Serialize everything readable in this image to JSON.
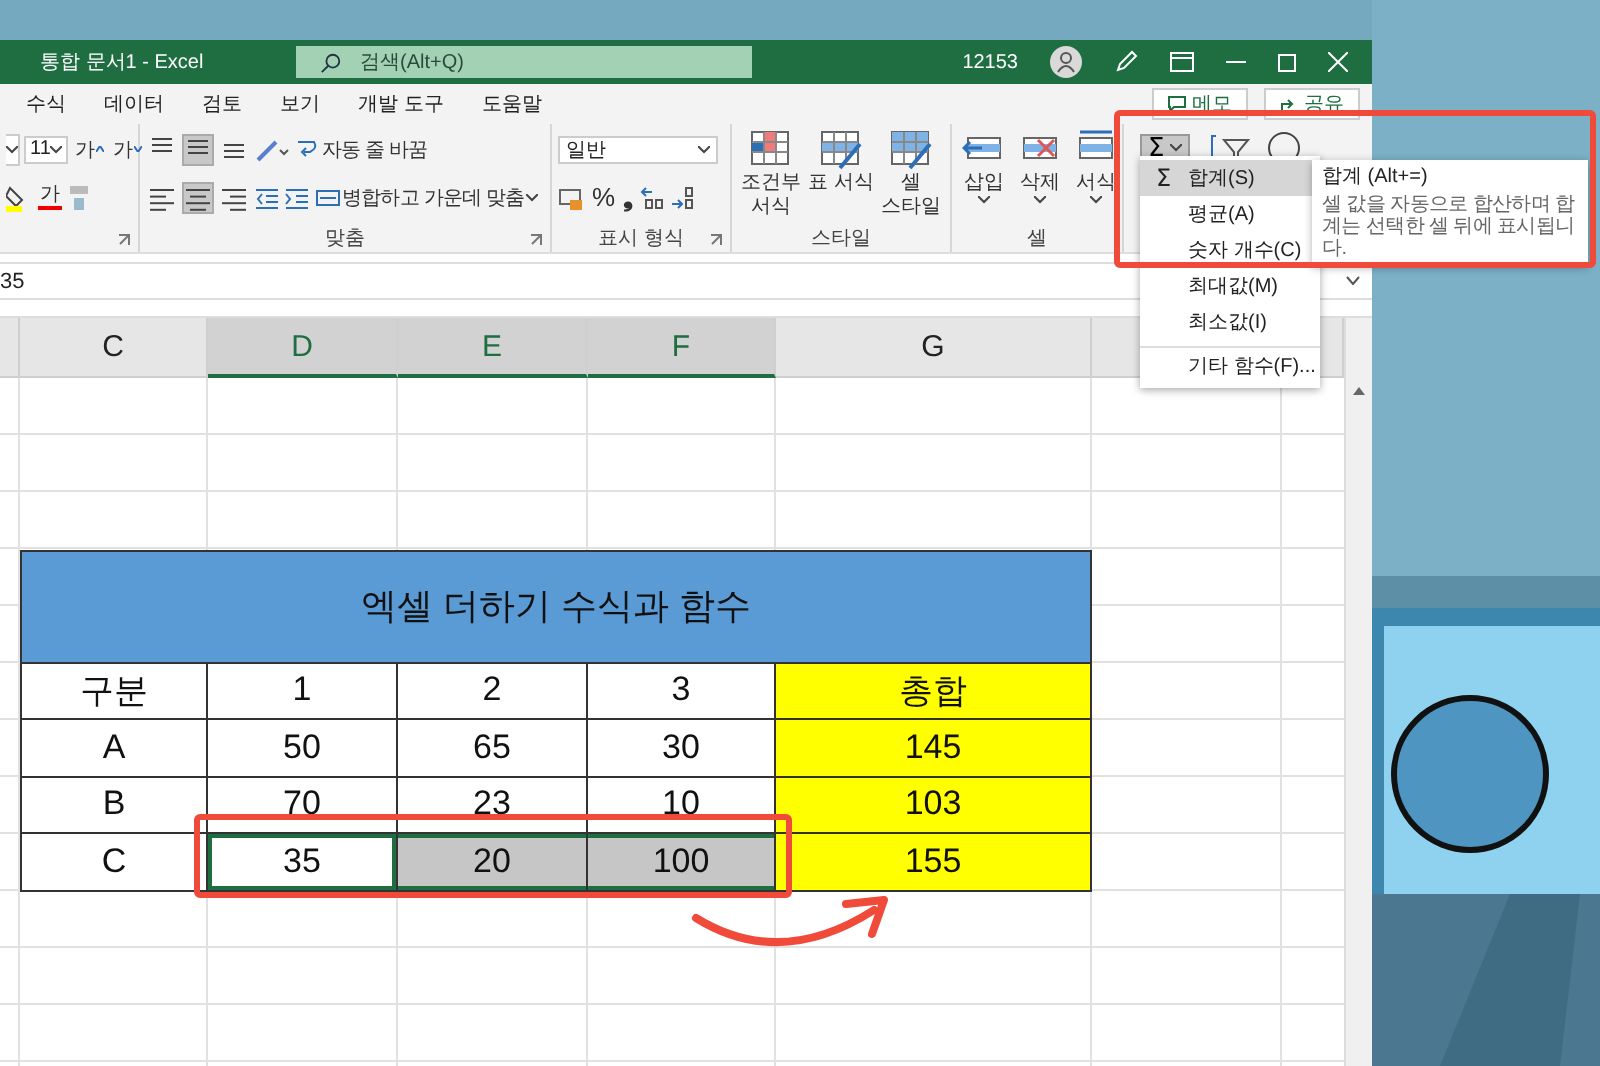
{
  "window": {
    "title": "통합 문서1 - Excel",
    "search_placeholder": "검색(Alt+Q)",
    "user": "12153"
  },
  "menu_tabs": [
    {
      "label": "수식",
      "selected": false
    },
    {
      "label": "데이터",
      "selected": false
    },
    {
      "label": "검토",
      "selected": false
    },
    {
      "label": "보기",
      "selected": false
    },
    {
      "label": "개발 도구",
      "selected": false
    },
    {
      "label": "도움말",
      "selected": false
    }
  ],
  "header_buttons": [
    {
      "kind": "comment",
      "label": "메모"
    },
    {
      "kind": "share",
      "label": "공유"
    }
  ],
  "ribbon": {
    "font": {
      "size": "11",
      "grow": "가",
      "shrink": "가",
      "font_color": "가"
    },
    "alignment": {
      "label": "맞춤",
      "vertical": [
        {
          "selected": false
        },
        {
          "selected": true
        },
        {
          "selected": false
        }
      ],
      "horizontal": [
        {
          "selected": false
        },
        {
          "selected": true
        },
        {
          "selected": false
        }
      ],
      "wrap_text": "자동 줄 바꿈",
      "merge": "병합하고 가운데 맞춤"
    },
    "number": {
      "label": "표시 형식",
      "format": "일반",
      "percent": "%",
      "comma": "❟"
    },
    "styles": {
      "label": "스타일",
      "buttons": [
        {
          "kind": "conditional",
          "label": "조건부 서식"
        },
        {
          "kind": "table",
          "label": "표 서식"
        },
        {
          "kind": "cell",
          "label": "셀 스타일"
        }
      ]
    },
    "cells": {
      "label": "셀",
      "buttons": [
        {
          "kind": "insert",
          "label": "삽입"
        },
        {
          "kind": "delete",
          "label": "삭제"
        },
        {
          "kind": "format",
          "label": "서식"
        }
      ]
    },
    "editing": {
      "autosum": "Σ",
      "autosum_open": true
    }
  },
  "formula_bar": {
    "value": "35"
  },
  "sheet": {
    "columns": [
      {
        "label": "C",
        "selected": false
      },
      {
        "label": "D",
        "selected": true
      },
      {
        "label": "E",
        "selected": true
      },
      {
        "label": "F",
        "selected": true
      },
      {
        "label": "G",
        "selected": false
      }
    ],
    "table": {
      "title": "엑셀 더하기 수식과 함수",
      "header": [
        "구분",
        "1",
        "2",
        "3",
        "총합"
      ],
      "rows": [
        {
          "cells": [
            {
              "text": "A",
              "selected": false,
              "active": false
            },
            {
              "text": "50",
              "selected": false,
              "active": false
            },
            {
              "text": "65",
              "selected": false,
              "active": false
            },
            {
              "text": "30",
              "selected": false,
              "active": false
            },
            {
              "text": "145",
              "selected": false,
              "active": false
            }
          ]
        },
        {
          "cells": [
            {
              "text": "B",
              "selected": false,
              "active": false
            },
            {
              "text": "70",
              "selected": false,
              "active": false
            },
            {
              "text": "23",
              "selected": false,
              "active": false
            },
            {
              "text": "10",
              "selected": false,
              "active": false
            },
            {
              "text": "103",
              "selected": false,
              "active": false
            }
          ]
        },
        {
          "cells": [
            {
              "text": "C",
              "selected": false,
              "active": false
            },
            {
              "text": "35",
              "selected": true,
              "active": true
            },
            {
              "text": "20",
              "selected": true,
              "active": false
            },
            {
              "text": "100",
              "selected": true,
              "active": false
            },
            {
              "text": "155",
              "selected": false,
              "active": false
            }
          ]
        }
      ]
    }
  },
  "autosum_menu": [
    {
      "symbol": "Σ",
      "label": "합계(S)",
      "selected": true,
      "separator_before": false
    },
    {
      "label": "평균(A)",
      "selected": false,
      "separator_before": false
    },
    {
      "label": "숫자 개수(C)",
      "selected": false,
      "separator_before": false
    },
    {
      "label": "최대값(M)",
      "selected": false,
      "separator_before": false
    },
    {
      "label": "최소값(I)",
      "selected": false,
      "separator_before": false
    },
    {
      "label": "기타 함수(F)...",
      "selected": false,
      "separator_before": true
    }
  ],
  "tooltip": {
    "title": "합계 (Alt+=)",
    "body": "셀 값을 자동으로 합산하며 합계는 선택한 셀 뒤에 표시됩니다."
  }
}
